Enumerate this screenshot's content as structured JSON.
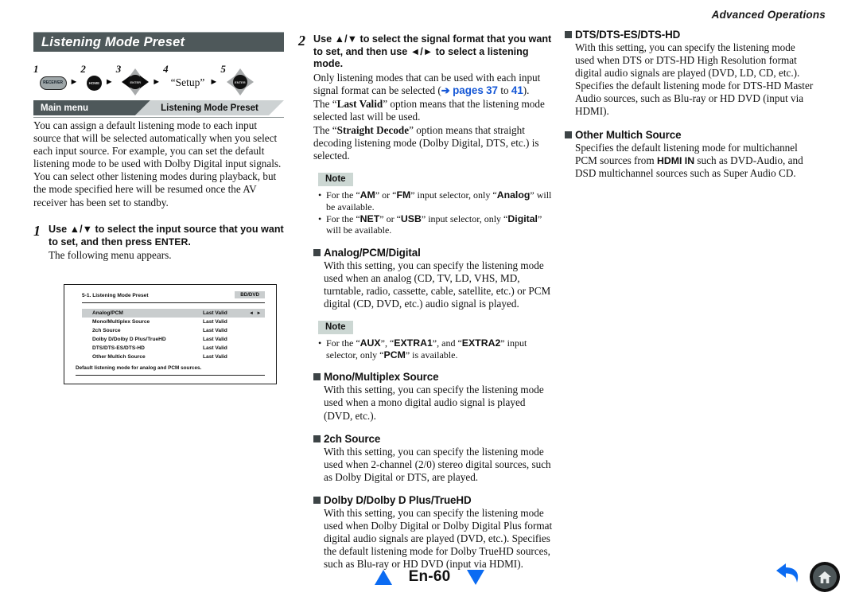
{
  "running_head": "Advanced Operations",
  "section": {
    "title": "Listening Mode Preset"
  },
  "key_sequence": {
    "steps": [
      {
        "num": "1",
        "type": "button",
        "label": "RECEIVER",
        "icon": "receiver-button-icon"
      },
      {
        "num": "2",
        "type": "button",
        "label": "HOME",
        "icon": "home-button-icon"
      },
      {
        "num": "3",
        "type": "dpad",
        "label": "ENTER",
        "icon": "dpad-enter-icon"
      },
      {
        "num": "4",
        "type": "word",
        "label": "“Setup”",
        "icon": ""
      },
      {
        "num": "5",
        "type": "dpad-gray",
        "label": "ENTER",
        "icon": "dpad-enter-icon"
      }
    ],
    "arrow": "►"
  },
  "breadcrumb": {
    "main": "Main menu",
    "current": "Listening Mode Preset"
  },
  "intro": "You can assign a default listening mode to each input source that will be selected automatically when you select each input source. For example, you can set the default listening mode to be used with Dolby Digital input signals. You can select other listening modes during playback, but the mode specified here will be resumed once the AV receiver has been set to standby.",
  "step1": {
    "num": "1",
    "lead_pre": "Use ▲/▼ to select the input source that you want to set, and then press ",
    "lead_bold": "ENTER",
    "lead_post": ".",
    "note": "The following menu appears."
  },
  "step2": {
    "num": "2",
    "lead": "Use ▲/▼ to select the signal format that you want to set, and then use ◄/► to select a listening mode.",
    "p1_pre": "Only listening modes that can be used with each input signal format can be selected (",
    "p1_link_arrow": "➔",
    "p1_link_label": "pages",
    "p1_page_from": "37",
    "p1_mid": " to ",
    "p1_page_to": "41",
    "p1_post": ").",
    "p2_pre": "The “",
    "p2_bold": "Last Valid",
    "p2_post": "” option means that the listening mode selected last will be used.",
    "p3_pre": "The “",
    "p3_bold": "Straight Decode",
    "p3_post": "” option means that straight decoding listening mode (Dolby Digital, DTS, etc.) is selected."
  },
  "screen": {
    "title": "5-1. Listening Mode Preset",
    "badge": "BD/DVD",
    "arrows": "◄ ►",
    "rows": [
      {
        "label": "Analog/PCM",
        "value": "Last Valid",
        "selected": true
      },
      {
        "label": "Mono/Multiplex Source",
        "value": "Last Valid",
        "selected": false
      },
      {
        "label": "2ch Source",
        "value": "Last Valid",
        "selected": false
      },
      {
        "label": "Dolby D/Dolby D Plus/TrueHD",
        "value": "Last Valid",
        "selected": false
      },
      {
        "label": "DTS/DTS-ES/DTS-HD",
        "value": "Last Valid",
        "selected": false
      },
      {
        "label": "Other Multich Source",
        "value": "Last Valid",
        "selected": false
      }
    ],
    "caption": "Default listening mode for analog and PCM sources."
  },
  "note1": {
    "tag": "Note",
    "items": [
      {
        "pre": "For the “",
        "b1": "AM",
        "mid1": "” or “",
        "b2": "FM",
        "mid2": "” input selector, only “",
        "b3": "Analog",
        "post": "” will be available."
      },
      {
        "pre": "For the “",
        "b1": "NET",
        "mid1": "” or “",
        "b2": "USB",
        "mid2": "” input selector, only “",
        "b3": "Digital",
        "post": "” will be available."
      }
    ]
  },
  "note2": {
    "tag": "Note",
    "items": [
      {
        "pre": "For the “",
        "b1": "AUX",
        "mid1": "”, “",
        "b2": "EXTRA1",
        "mid2": "”, and “",
        "b3": "EXTRA2",
        "post": "” input selector, only “",
        "b4": "PCM",
        "post2": "” is available."
      }
    ]
  },
  "sections": [
    {
      "heading": "Analog/PCM/Digital",
      "body": "With this setting, you can specify the listening mode used when an analog (CD, TV, LD, VHS, MD, turntable, radio, cassette, cable, satellite, etc.) or PCM digital (CD, DVD, etc.) audio signal is played."
    },
    {
      "heading": "Mono/Multiplex Source",
      "body": "With this setting, you can specify the listening mode used when a mono digital audio signal is played (DVD, etc.)."
    },
    {
      "heading": "2ch Source",
      "body": "With this setting, you can specify the listening mode used when 2-channel (2/0) stereo digital sources, such as Dolby Digital or DTS, are played."
    },
    {
      "heading": "Dolby D/Dolby D Plus/TrueHD",
      "body": "With this setting, you can specify the listening mode used when Dolby Digital or Dolby Digital Plus format digital audio signals are played (DVD, etc.). Specifies the default listening mode for Dolby TrueHD sources, such as Blu-ray or HD DVD (input via HDMI)."
    },
    {
      "heading": "DTS/DTS-ES/DTS-HD",
      "body": "With this setting, you can specify the listening mode used when DTS or DTS-HD High Resolution format digital audio signals are played (DVD, LD, CD, etc.). Specifies the default listening mode for DTS-HD Master Audio sources, such as Blu-ray or HD DVD (input via HDMI)."
    },
    {
      "heading": "Other Multich Source",
      "body_pre": "Specifies the default listening mode for multichannel PCM sources from ",
      "body_bold": "HDMI IN",
      "body_post": " such as DVD-Audio, and DSD multichannel sources such as Super Audio CD."
    }
  ],
  "footer": {
    "page_label": "En-60",
    "prev_icon": "triangle-up-icon",
    "next_icon": "triangle-down-icon",
    "back_icon": "back-arrow-icon",
    "home_icon": "home-icon"
  },
  "colors": {
    "title_bar": "#4e585a",
    "crumb_sub": "#cdd2d3",
    "link": "#1557d6",
    "pager": "#0b6bf2",
    "note_tag": "#ccd7d3"
  }
}
